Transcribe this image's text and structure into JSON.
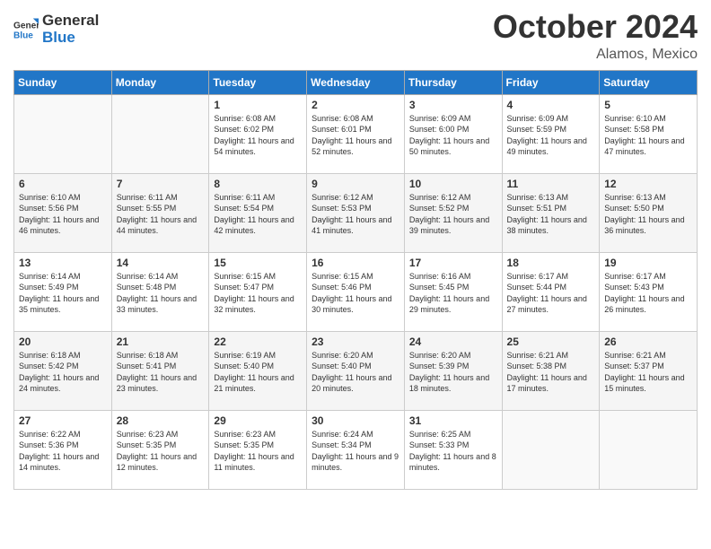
{
  "header": {
    "logo_line1": "General",
    "logo_line2": "Blue",
    "month": "October 2024",
    "location": "Alamos, Mexico"
  },
  "weekdays": [
    "Sunday",
    "Monday",
    "Tuesday",
    "Wednesday",
    "Thursday",
    "Friday",
    "Saturday"
  ],
  "weeks": [
    [
      {
        "day": "",
        "info": ""
      },
      {
        "day": "",
        "info": ""
      },
      {
        "day": "1",
        "info": "Sunrise: 6:08 AM\nSunset: 6:02 PM\nDaylight: 11 hours and 54 minutes."
      },
      {
        "day": "2",
        "info": "Sunrise: 6:08 AM\nSunset: 6:01 PM\nDaylight: 11 hours and 52 minutes."
      },
      {
        "day": "3",
        "info": "Sunrise: 6:09 AM\nSunset: 6:00 PM\nDaylight: 11 hours and 50 minutes."
      },
      {
        "day": "4",
        "info": "Sunrise: 6:09 AM\nSunset: 5:59 PM\nDaylight: 11 hours and 49 minutes."
      },
      {
        "day": "5",
        "info": "Sunrise: 6:10 AM\nSunset: 5:58 PM\nDaylight: 11 hours and 47 minutes."
      }
    ],
    [
      {
        "day": "6",
        "info": "Sunrise: 6:10 AM\nSunset: 5:56 PM\nDaylight: 11 hours and 46 minutes."
      },
      {
        "day": "7",
        "info": "Sunrise: 6:11 AM\nSunset: 5:55 PM\nDaylight: 11 hours and 44 minutes."
      },
      {
        "day": "8",
        "info": "Sunrise: 6:11 AM\nSunset: 5:54 PM\nDaylight: 11 hours and 42 minutes."
      },
      {
        "day": "9",
        "info": "Sunrise: 6:12 AM\nSunset: 5:53 PM\nDaylight: 11 hours and 41 minutes."
      },
      {
        "day": "10",
        "info": "Sunrise: 6:12 AM\nSunset: 5:52 PM\nDaylight: 11 hours and 39 minutes."
      },
      {
        "day": "11",
        "info": "Sunrise: 6:13 AM\nSunset: 5:51 PM\nDaylight: 11 hours and 38 minutes."
      },
      {
        "day": "12",
        "info": "Sunrise: 6:13 AM\nSunset: 5:50 PM\nDaylight: 11 hours and 36 minutes."
      }
    ],
    [
      {
        "day": "13",
        "info": "Sunrise: 6:14 AM\nSunset: 5:49 PM\nDaylight: 11 hours and 35 minutes."
      },
      {
        "day": "14",
        "info": "Sunrise: 6:14 AM\nSunset: 5:48 PM\nDaylight: 11 hours and 33 minutes."
      },
      {
        "day": "15",
        "info": "Sunrise: 6:15 AM\nSunset: 5:47 PM\nDaylight: 11 hours and 32 minutes."
      },
      {
        "day": "16",
        "info": "Sunrise: 6:15 AM\nSunset: 5:46 PM\nDaylight: 11 hours and 30 minutes."
      },
      {
        "day": "17",
        "info": "Sunrise: 6:16 AM\nSunset: 5:45 PM\nDaylight: 11 hours and 29 minutes."
      },
      {
        "day": "18",
        "info": "Sunrise: 6:17 AM\nSunset: 5:44 PM\nDaylight: 11 hours and 27 minutes."
      },
      {
        "day": "19",
        "info": "Sunrise: 6:17 AM\nSunset: 5:43 PM\nDaylight: 11 hours and 26 minutes."
      }
    ],
    [
      {
        "day": "20",
        "info": "Sunrise: 6:18 AM\nSunset: 5:42 PM\nDaylight: 11 hours and 24 minutes."
      },
      {
        "day": "21",
        "info": "Sunrise: 6:18 AM\nSunset: 5:41 PM\nDaylight: 11 hours and 23 minutes."
      },
      {
        "day": "22",
        "info": "Sunrise: 6:19 AM\nSunset: 5:40 PM\nDaylight: 11 hours and 21 minutes."
      },
      {
        "day": "23",
        "info": "Sunrise: 6:20 AM\nSunset: 5:40 PM\nDaylight: 11 hours and 20 minutes."
      },
      {
        "day": "24",
        "info": "Sunrise: 6:20 AM\nSunset: 5:39 PM\nDaylight: 11 hours and 18 minutes."
      },
      {
        "day": "25",
        "info": "Sunrise: 6:21 AM\nSunset: 5:38 PM\nDaylight: 11 hours and 17 minutes."
      },
      {
        "day": "26",
        "info": "Sunrise: 6:21 AM\nSunset: 5:37 PM\nDaylight: 11 hours and 15 minutes."
      }
    ],
    [
      {
        "day": "27",
        "info": "Sunrise: 6:22 AM\nSunset: 5:36 PM\nDaylight: 11 hours and 14 minutes."
      },
      {
        "day": "28",
        "info": "Sunrise: 6:23 AM\nSunset: 5:35 PM\nDaylight: 11 hours and 12 minutes."
      },
      {
        "day": "29",
        "info": "Sunrise: 6:23 AM\nSunset: 5:35 PM\nDaylight: 11 hours and 11 minutes."
      },
      {
        "day": "30",
        "info": "Sunrise: 6:24 AM\nSunset: 5:34 PM\nDaylight: 11 hours and 9 minutes."
      },
      {
        "day": "31",
        "info": "Sunrise: 6:25 AM\nSunset: 5:33 PM\nDaylight: 11 hours and 8 minutes."
      },
      {
        "day": "",
        "info": ""
      },
      {
        "day": "",
        "info": ""
      }
    ]
  ]
}
